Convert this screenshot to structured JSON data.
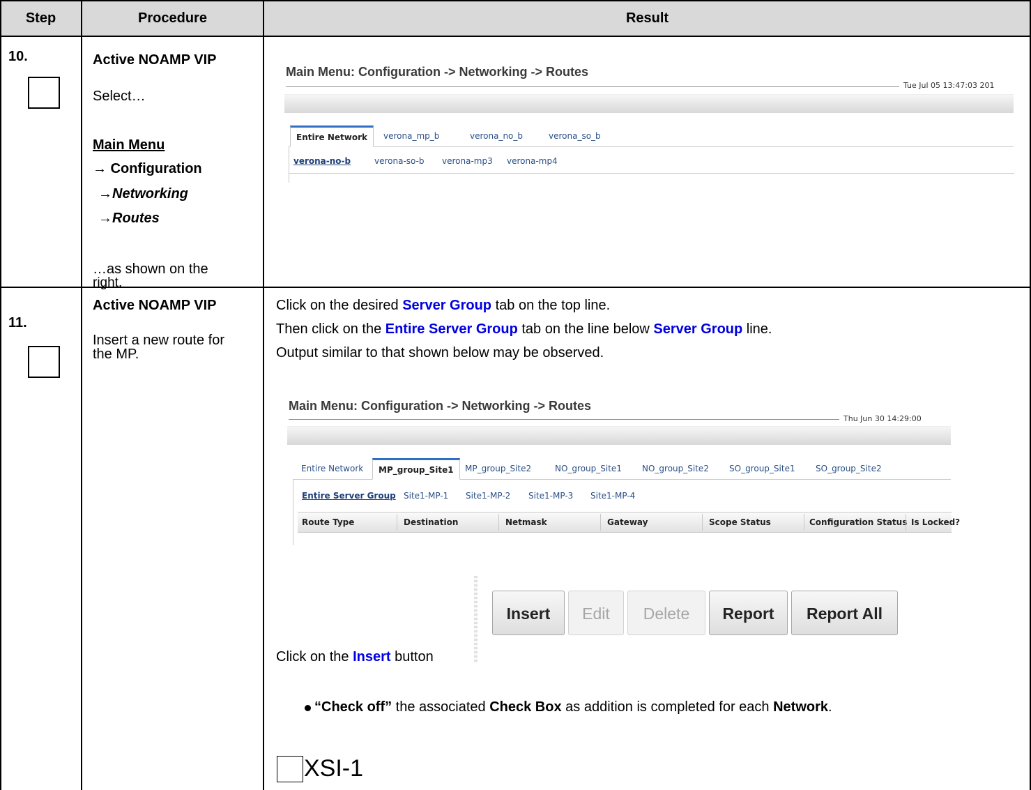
{
  "header": {
    "step": "Step",
    "procedure": "Procedure",
    "result": "Result"
  },
  "step10": {
    "number": "10.",
    "title": "Active NOAMP VIP",
    "select": "Select…",
    "menu_main": "Main Menu",
    "menu_configuration": "→ Configuration",
    "menu_networking": "→Networking",
    "menu_routes": "→Routes",
    "as_shown_1": "…as shown on the",
    "as_shown_2": "right.",
    "screen": {
      "title": "Main Menu: Configuration -> Networking -> Routes",
      "timestamp": "Tue Jul 05 13:47:03 201",
      "tabs": [
        "Entire Network",
        "verona_mp_b",
        "verona_no_b",
        "verona_so_b"
      ],
      "active_tab": "Entire Network",
      "subtabs": [
        "verona-no-b",
        "verona-so-b",
        "verona-mp3",
        "verona-mp4"
      ],
      "active_subtab": "verona-no-b"
    }
  },
  "step11": {
    "number": "11.",
    "title": "Active NOAMP VIP",
    "desc_1": "Insert a new route for",
    "desc_2": "the MP.",
    "line1_a": "Click on the desired ",
    "line1_b": "Server Group",
    "line1_c": " tab on the top line.",
    "line2_a": "Then click on the ",
    "line2_b": "Entire Server Group",
    "line2_c": " tab on the line below ",
    "line2_d": "Server Group",
    "line2_e": " line.",
    "line3": "Output similar to that shown below may be observed.",
    "screen": {
      "title": "Main Menu: Configuration -> Networking -> Routes",
      "timestamp": "Thu Jun 30 14:29:00",
      "tabs": [
        "Entire Network",
        "MP_group_Site1",
        "MP_group_Site2",
        "NO_group_Site1",
        "NO_group_Site2",
        "SO_group_Site1",
        "SO_group_Site2"
      ],
      "active_tab": "MP_group_Site1",
      "subtabs": [
        "Entire Server Group",
        "Site1-MP-1",
        "Site1-MP-2",
        "Site1-MP-3",
        "Site1-MP-4"
      ],
      "active_subtab": "Entire Server Group",
      "columns": [
        "Route Type",
        "Destination",
        "Netmask",
        "Gateway",
        "Scope Status",
        "Configuration Status",
        "Is Locked?"
      ]
    },
    "buttons": {
      "insert": "Insert",
      "edit": "Edit",
      "delete": "Delete",
      "report": "Report",
      "report_all": "Report All"
    },
    "click_a": "Click on the ",
    "click_b": "Insert",
    "click_c": "  button",
    "bullet_a": "“Check off”",
    "bullet_b": " the associated ",
    "bullet_c": "Check Box",
    "bullet_d": " as addition is completed for each ",
    "bullet_e": "Network",
    "bullet_f": ".",
    "checkbox_label": "XSI-1"
  }
}
